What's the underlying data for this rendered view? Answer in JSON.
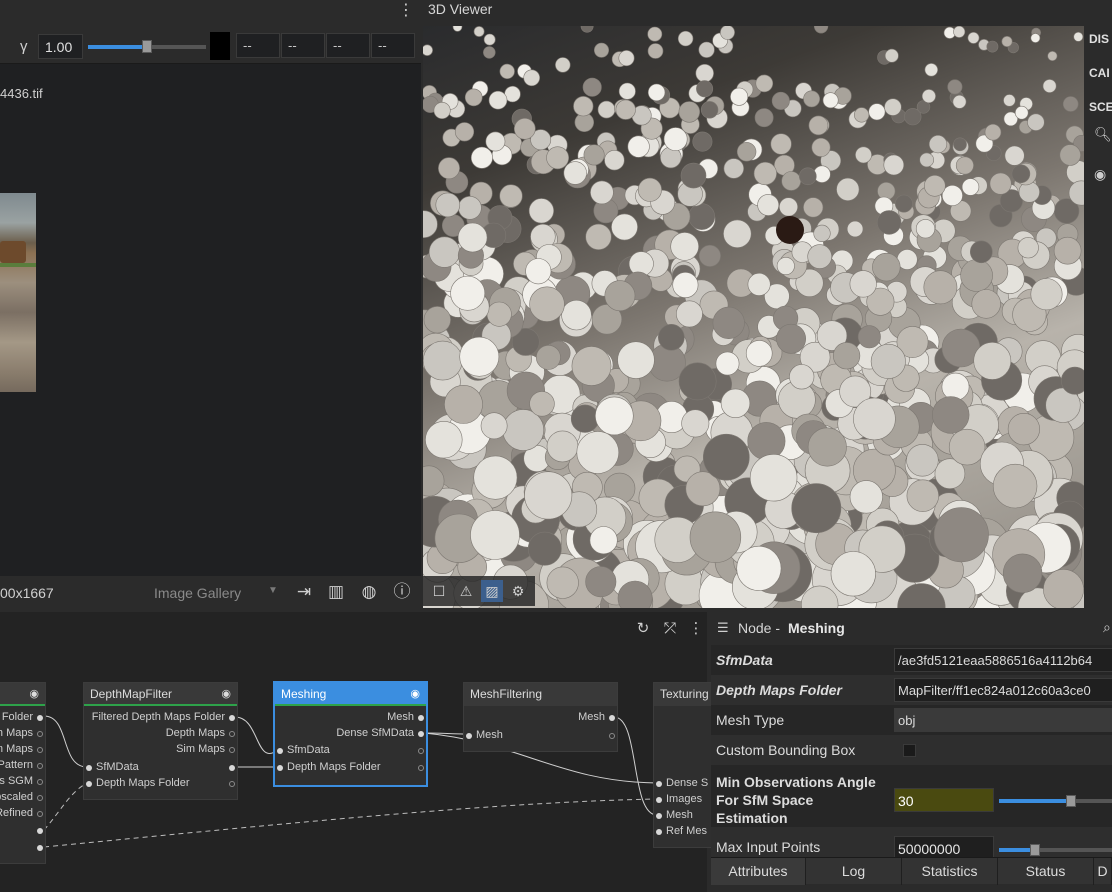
{
  "image_viewer": {
    "gamma_symbol": "γ",
    "gamma_value": "1.00",
    "gamma_fraction": 0.5,
    "pixel_values": [
      "--",
      "--",
      "--",
      "--"
    ],
    "menu_icon": "⋮",
    "filename": "4436.tif",
    "resolution": "00x1667",
    "gallery_select": "Image Gallery",
    "icons": [
      "export-icon",
      "chart-icon",
      "globe-icon",
      "info-icon"
    ]
  },
  "viewer3d": {
    "title": "3D Viewer",
    "side_tabs": [
      "DIS",
      "CAI",
      "SCE"
    ],
    "tool_icons": [
      "square-icon",
      "warning-icon",
      "hatch-icon",
      "settings-icon"
    ]
  },
  "graph": {
    "nodes": [
      {
        "name": "",
        "outputs": [
          "Folder",
          "h Maps",
          "m Maps",
          "Pattern",
          "os SGM",
          "pscaled",
          "Refined"
        ]
      },
      {
        "name": "DepthMapFilter",
        "outputs": [
          "Filtered Depth Maps Folder",
          "Depth Maps",
          "Sim Maps"
        ],
        "inputs": [
          "SfMData",
          "Depth Maps Folder"
        ]
      },
      {
        "name": "Meshing",
        "outputs": [
          "Mesh",
          "Dense SfMData"
        ],
        "inputs": [
          "SfmData",
          "Depth Maps Folder"
        ]
      },
      {
        "name": "MeshFiltering",
        "outputs": [
          "Mesh"
        ],
        "inputs": [
          "Mesh"
        ]
      },
      {
        "name": "Texturing",
        "inputs": [
          "Dense S",
          "Images",
          "Mesh",
          "Ref Mes"
        ]
      }
    ]
  },
  "attributes": {
    "node_label": "Node - ",
    "node_name": "Meshing",
    "rows": [
      {
        "label": "SfmData",
        "value": "/ae3fd5121eaa5886516a4112b64"
      },
      {
        "label": "Depth Maps Folder",
        "value": "MapFilter/ff1ec824a012c60a3ce0"
      },
      {
        "label": "Mesh Type",
        "value": "obj"
      },
      {
        "label": "Custom Bounding Box",
        "value": ""
      },
      {
        "label": "Min Observations Angle For SfM Space Estimation",
        "value": "30",
        "fraction": 0.6
      },
      {
        "label": "Max Input Points",
        "value": "50000000",
        "fraction": 0.3
      }
    ],
    "tabs": [
      "Attributes",
      "Log",
      "Statistics",
      "Status",
      "D"
    ]
  },
  "colors": {
    "accent": "#3b8ee0",
    "node_ok": "#2ea24a",
    "highlight": "#4a4a10"
  }
}
